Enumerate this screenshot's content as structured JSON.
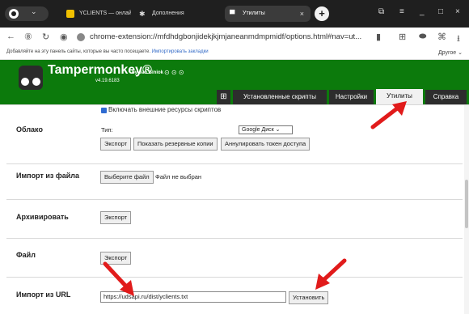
{
  "browser": {
    "menu_icon": "≡",
    "tabs": [
      {
        "label": "YCLIENTS — онлайн-запи",
        "icon": "yclients-icon"
      },
      {
        "label": "Дополнения",
        "icon": "puzzle-icon"
      },
      {
        "label": "Утилиты",
        "icon": "tampermonkey-icon",
        "close": "×"
      }
    ],
    "new_tab": "+",
    "window_controls": {
      "pin": "⧉",
      "menu": "≡",
      "minimize": "_",
      "maximize": "□",
      "close": "×"
    },
    "nav": {
      "back": "←",
      "forward": "→",
      "refresh": "↻"
    },
    "url": "chrome-extension://mfdhdgbonjidekjkjmjaneanmdmpmidf/options.html#nav=ut...",
    "toolbar": {
      "bookmark": "▮",
      "extensions": "⊞",
      "download": "⭳"
    },
    "bookmarks_bar": {
      "prompt": "Добавляйте на эту панель сайты, которые вы часто посещаете.",
      "import_link": "Импортировать закладки",
      "other": "Другое ⌄"
    }
  },
  "tampermonkey": {
    "title": "Tampermonkey®",
    "by": "by Jan Biniok",
    "social": "⊙ ⊙ ⊙",
    "version": "v4.19.6183",
    "tabs": {
      "new_script": "⊞",
      "installed": "Установленные скрипты",
      "settings": "Настройки",
      "utilities": "Утилиты",
      "help": "Справка"
    }
  },
  "content": {
    "top_checkbox_label": "Включать внешние ресурсы скриптов",
    "cloud": {
      "label": "Облако",
      "type_label": "Тип:",
      "type_value": "Google Диск ⌄",
      "export": "Экспорт",
      "show_backups": "Показать резервные копии",
      "revoke_token": "Аннулировать токен доступа"
    },
    "import_file": {
      "label": "Импорт из файла",
      "choose": "Выберите файл",
      "status": "Файл не выбран"
    },
    "archive": {
      "label": "Архивировать",
      "export": "Экспорт"
    },
    "file": {
      "label": "Файл",
      "export": "Экспорт"
    },
    "import_url": {
      "label": "Импорт из URL",
      "value": "https://udsapi.ru/dist/yclients.txt",
      "install": "Установить"
    }
  },
  "annotation_color": "#e11b1b"
}
